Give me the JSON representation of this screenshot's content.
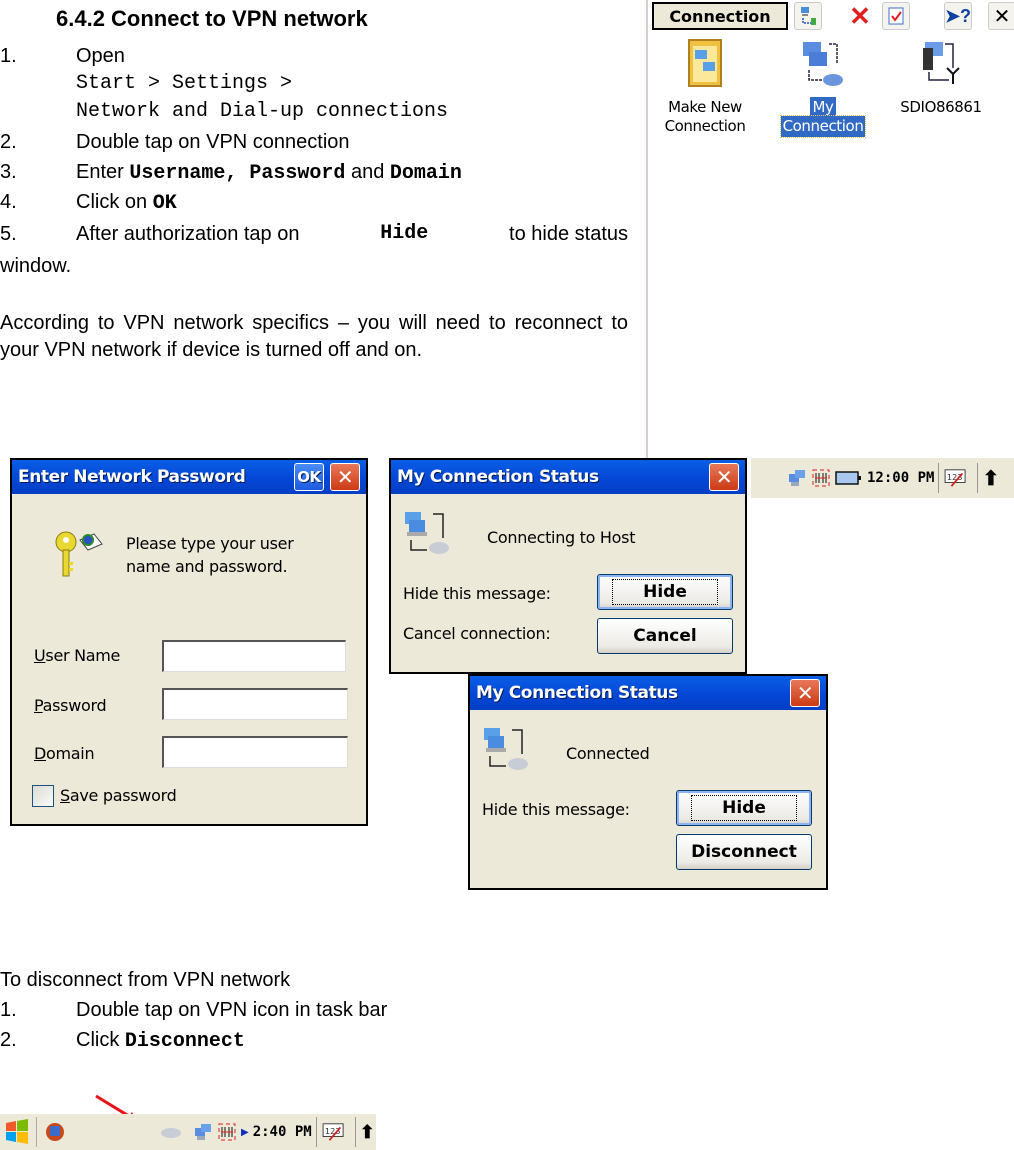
{
  "heading": "6.4.2 Connect to VPN network",
  "steps": [
    {
      "num": "1.",
      "text": "Open"
    },
    {
      "num": "",
      "path_line1": "Start > Settings >",
      "path_line2": "Network and Dial-up connections"
    },
    {
      "num": "2.",
      "text": "Double tap on VPN connection"
    },
    {
      "num": "3.",
      "prefix": "Enter",
      "b1": "Username, Password",
      "mid": "and",
      "b2": "Domain"
    },
    {
      "num": "4.",
      "prefix": "Click on",
      "b1": "OK"
    },
    {
      "num": "5.",
      "prefix": "After authorization tap on",
      "b1": "Hide",
      "suffix": "to hide status",
      "cont": "window."
    }
  ],
  "note": "According to VPN network specifics – you will need to reconnect to your VPN network if device is turned off and on.",
  "explorer": {
    "menu_label": "Connection",
    "toolbar_icons": [
      "new-connection-icon",
      "delete-icon",
      "properties-icon",
      "help-icon",
      "close-icon"
    ],
    "items": [
      {
        "line1": "Make New",
        "line2": "Connection",
        "icon": "make-new-connection-icon",
        "selected": false
      },
      {
        "line1": "My",
        "line2": "Connection",
        "icon": "vpn-connection-icon",
        "selected": true
      },
      {
        "line1": "SDIO86861",
        "line2": "",
        "icon": "wireless-connection-icon",
        "selected": false
      }
    ]
  },
  "password_dialog": {
    "title": "Enter Network Password",
    "ok_label": "OK",
    "close_label": "✕",
    "prompt_line1": "Please type your user",
    "prompt_line2": "name and password.",
    "fields": [
      {
        "label_first": "U",
        "label_rest": "ser Name",
        "value": ""
      },
      {
        "label_first": "P",
        "label_rest": "assword",
        "value": ""
      },
      {
        "label_first": "D",
        "label_rest": "omain",
        "value": ""
      }
    ],
    "save_password": {
      "first": "S",
      "rest": "ave password",
      "checked": false
    }
  },
  "status_dialog_1": {
    "title": "My Connection Status",
    "close_label": "✕",
    "status": "Connecting to Host",
    "hide_label": "Hide this message:",
    "hide_button": "Hide",
    "cancel_label": "Cancel connection:",
    "cancel_button": "Cancel"
  },
  "status_dialog_2": {
    "title": "My Connection Status",
    "close_label": "✕",
    "status": "Connected",
    "hide_label": "Hide this message:",
    "hide_button": "Hide",
    "disconnect_button": "Disconnect"
  },
  "taskbar_top": {
    "clock": "12:00 PM",
    "input_panel": "123"
  },
  "disconnect_section": {
    "intro": "To disconnect from VPN network",
    "steps": [
      {
        "num": "1.",
        "text": "Double tap on VPN icon in task bar"
      },
      {
        "num": "2.",
        "prefix": "Click",
        "b1": "Disconnect"
      }
    ]
  },
  "taskbar_bottom": {
    "clock": "2:40 PM",
    "input_panel": "123"
  },
  "colors": {
    "titlebar": "#0548d8",
    "dialog_bg": "#ece9d8",
    "selection": "#316ac5",
    "close_red": "#cc3a14",
    "arrow_red": "#e8141c"
  }
}
